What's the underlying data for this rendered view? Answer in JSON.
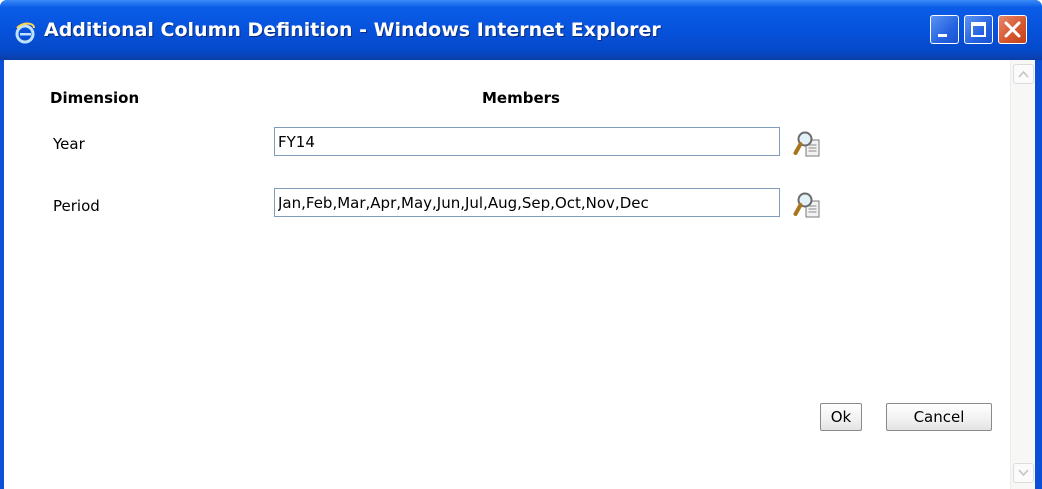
{
  "window": {
    "title": "Additional Column Definition - Windows Internet Explorer",
    "icon": "ie-icon",
    "controls": [
      "minimize-icon",
      "maximize-icon",
      "close-icon"
    ]
  },
  "table": {
    "headers": {
      "dimension": "Dimension",
      "members": "Members"
    },
    "rows": [
      {
        "label": "Year",
        "value": "FY14",
        "lookup_icon": "member-selector-icon"
      },
      {
        "label": "Period",
        "value": "Jan,Feb,Mar,Apr,May,Jun,Jul,Aug,Sep,Oct,Nov,Dec",
        "lookup_icon": "member-selector-icon"
      }
    ]
  },
  "buttons": {
    "ok": "Ok",
    "cancel": "Cancel"
  },
  "colors": {
    "titlebar": "#0652dc",
    "field_border": "#7f9db9",
    "close_button": "#d3552d"
  }
}
